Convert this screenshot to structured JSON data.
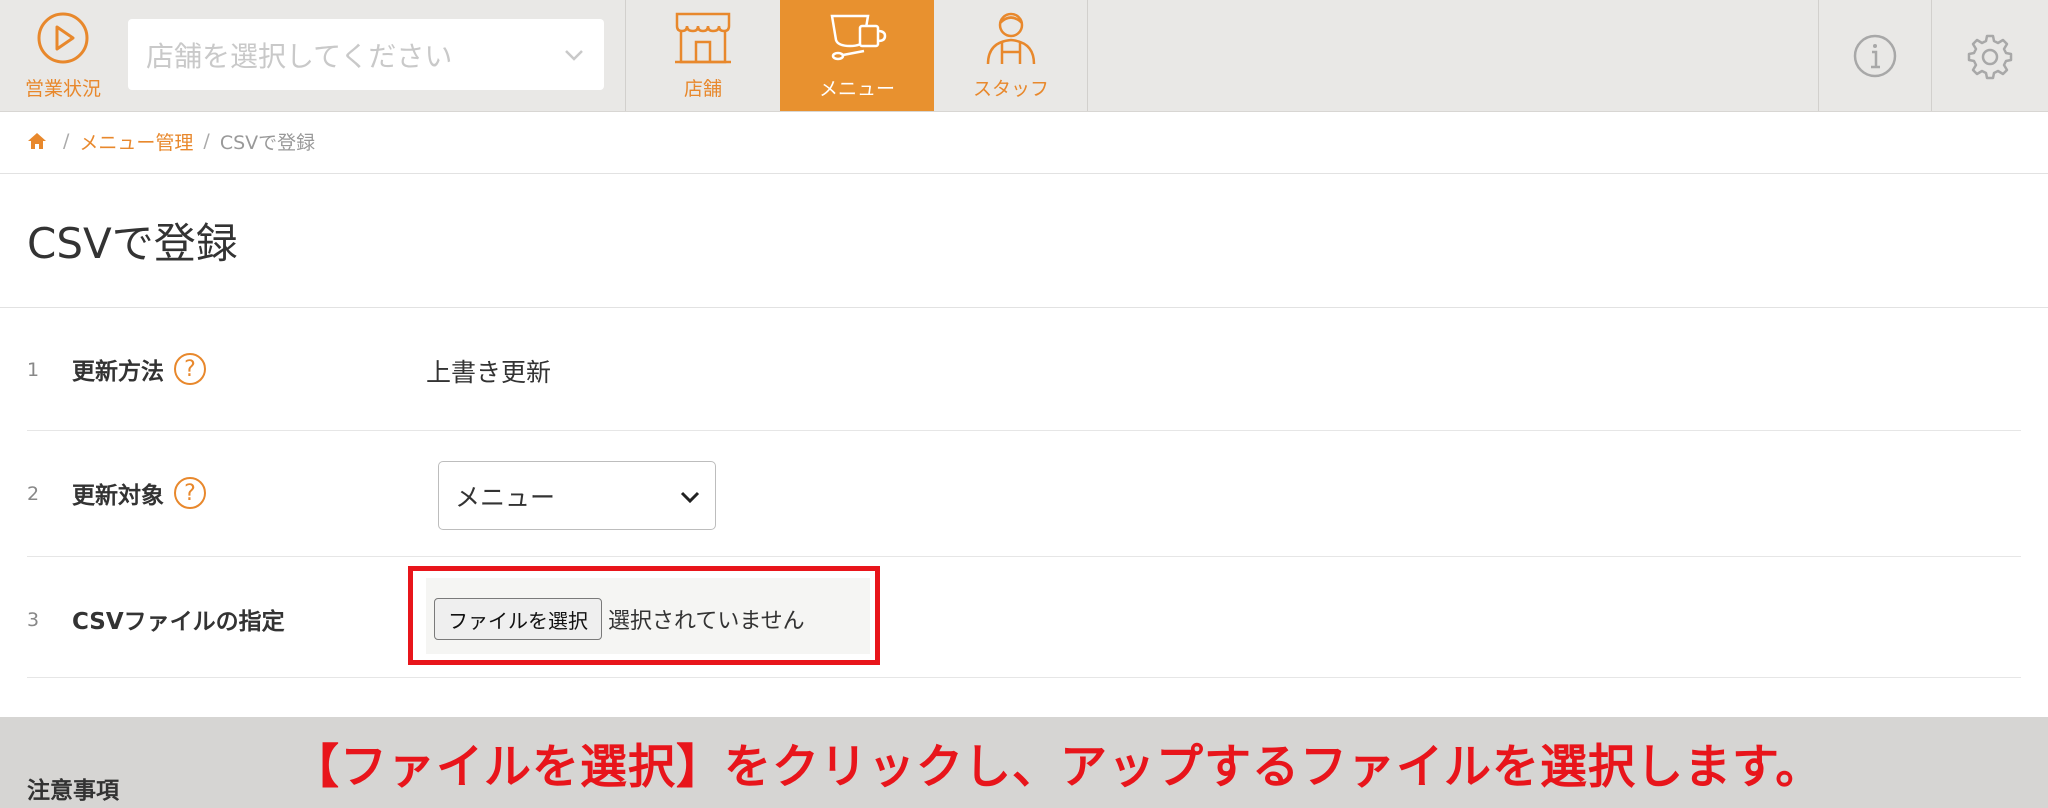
{
  "colors": {
    "accent": "#e8882c",
    "active_nav_bg": "#e8912f",
    "highlight": "#e8151b",
    "topbar_bg": "#e9e8e6"
  },
  "topbar": {
    "status_label": "営業状況",
    "status_icon": "play-circle-icon",
    "store_select_placeholder": "店舗を選択してください",
    "nav": [
      {
        "label": "店舗",
        "icon": "storefront-icon",
        "active": false
      },
      {
        "label": "メニュー",
        "icon": "cup-menu-icon",
        "active": true
      },
      {
        "label": "スタッフ",
        "icon": "staff-icon",
        "active": false
      }
    ],
    "info_icon": "info-icon",
    "settings_icon": "gear-icon"
  },
  "breadcrumb": {
    "home_icon": "home-icon",
    "items": [
      "メニュー管理",
      "CSVで登録"
    ]
  },
  "page_title": "CSVで登録",
  "form": {
    "rows": [
      {
        "num": "1",
        "label": "更新方法",
        "value": "上書き更新"
      },
      {
        "num": "2",
        "label": "更新対象",
        "value": "メニュー"
      },
      {
        "num": "3",
        "label": "CSVファイルの指定",
        "button": "ファイルを選択",
        "status": "選択されていません"
      }
    ],
    "help_glyph": "?"
  },
  "notes_title": "注意事項",
  "caption": "【ファイルを選択】をクリックし、アップするファイルを選択します。"
}
